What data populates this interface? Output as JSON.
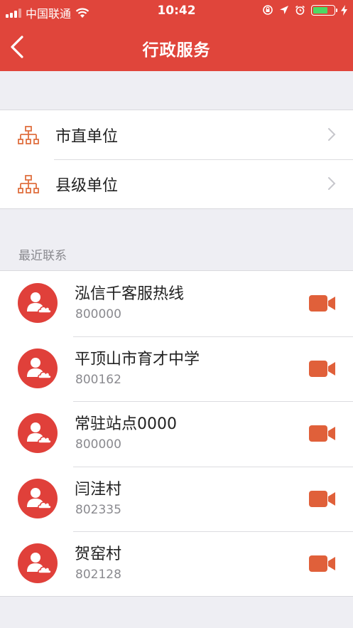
{
  "status_bar": {
    "carrier": "中国联通",
    "time": "10:42",
    "battery_color": "#4cd964"
  },
  "navbar": {
    "back_icon": "chevron-left-icon",
    "title": "行政服务"
  },
  "org_units": [
    {
      "label": "市直单位",
      "icon": "org-chart-icon"
    },
    {
      "label": "县级单位",
      "icon": "org-chart-icon"
    }
  ],
  "recent": {
    "title": "最近联系",
    "contacts": [
      {
        "name": "泓信千客服热线",
        "number": "800000"
      },
      {
        "name": "平顶山市育才中学",
        "number": "800162"
      },
      {
        "name": "常驻站点0000",
        "number": "800000"
      },
      {
        "name": "闫洼村",
        "number": "802335"
      },
      {
        "name": "贺窑村",
        "number": "802128"
      }
    ]
  },
  "colors": {
    "accent": "#e0453b",
    "icon_orange": "#e07040",
    "video_icon": "#e0603a"
  }
}
